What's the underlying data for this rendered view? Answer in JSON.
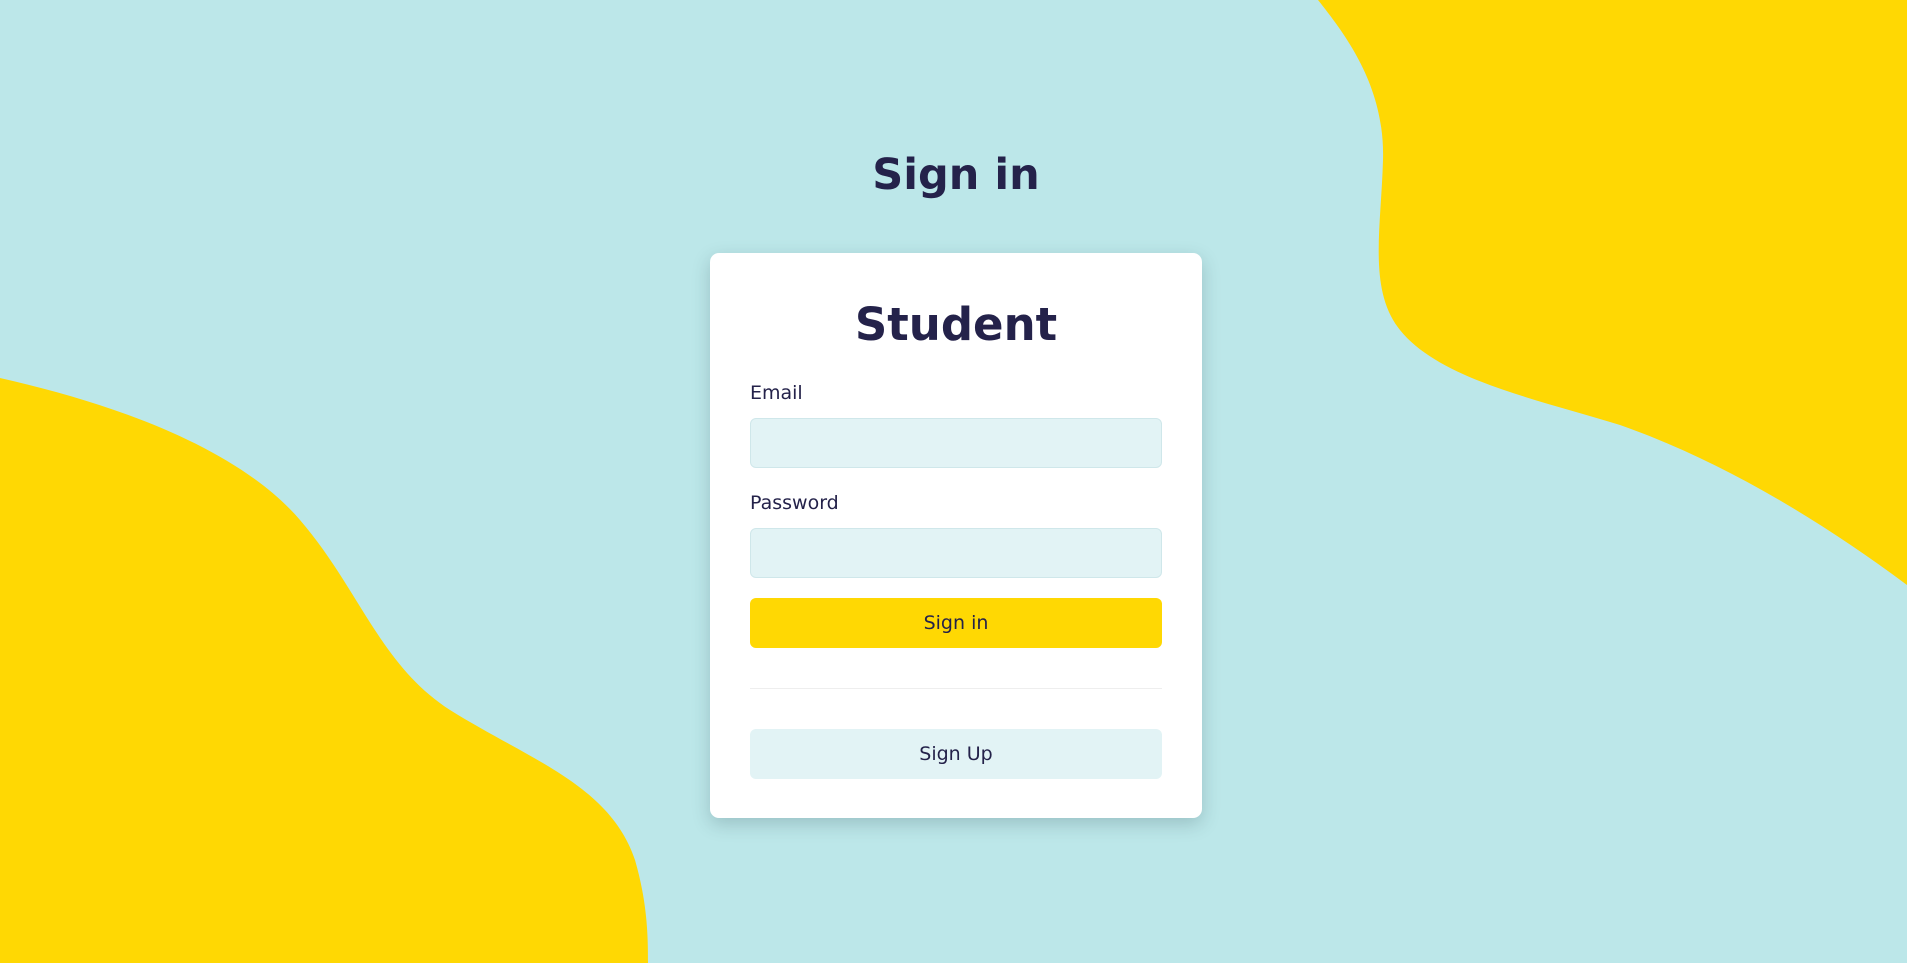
{
  "colors": {
    "background": "#bce7e9",
    "accent_yellow": "#ffd803",
    "text_dark": "#24224a",
    "input_bg": "#e2f3f5",
    "card_bg": "#ffffff"
  },
  "page": {
    "title": "Sign in"
  },
  "card": {
    "title": "Student",
    "email_label": "Email",
    "email_value": "",
    "password_label": "Password",
    "password_value": "",
    "signin_label": "Sign in",
    "signup_label": "Sign Up"
  }
}
